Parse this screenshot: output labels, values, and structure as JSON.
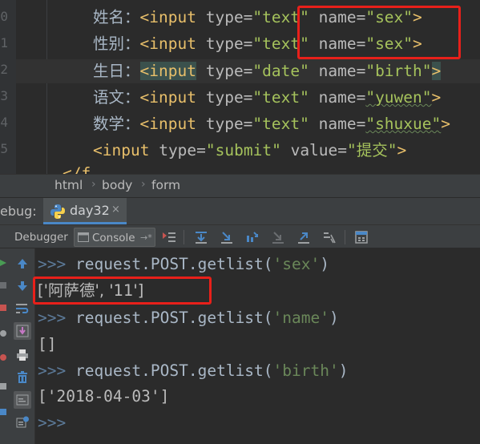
{
  "editor": {
    "line_numbers": [
      "0",
      "1",
      "2",
      "3",
      "4",
      "5"
    ],
    "lines": [
      {
        "label": "姓名：",
        "tag": "<input",
        "attr1": "type=",
        "val1": "\"text\"",
        "attr2": "name=",
        "val2": "\"sex\"",
        "close": ">"
      },
      {
        "label": "性别：",
        "tag": "<input",
        "attr1": "type=",
        "val1": "\"text\"",
        "attr2": "name=",
        "val2": "\"sex\"",
        "close": ">"
      },
      {
        "label": "生日：",
        "tag": "<input",
        "attr1": "type=",
        "val1": "\"date\"",
        "attr2": "name=",
        "val2": "\"birth\"",
        "close": ">"
      },
      {
        "label": "语文：",
        "tag": "<input",
        "attr1": "type=",
        "val1": "\"text\"",
        "attr2": "name=",
        "val2": "\"yuwen\"",
        "close": ">"
      },
      {
        "label": "数学：",
        "tag": "<input",
        "attr1": "type=",
        "val1": "\"text\"",
        "attr2": "name=",
        "val2": "\"shuxue\"",
        "close": ">"
      }
    ],
    "submit_line": {
      "tag": "<input",
      "attr1": "type=",
      "val1": "\"submit\"",
      "attr2": "value=",
      "val2": "\"提交\"",
      "close": ">"
    },
    "partial_line": "</f"
  },
  "breadcrumb": [
    "html",
    "body",
    "form"
  ],
  "debug": {
    "label": "ebug:",
    "tab_name": "day32",
    "close_glyph": "×"
  },
  "toolbar": {
    "debugger_label": "Debugger",
    "console_label": "Console",
    "console_suffix": "→*"
  },
  "console": {
    "prompt": ">>>",
    "lines": [
      {
        "kind": "input",
        "cmd": "request.POST.getlist(",
        "arg": "'sex'",
        "end": ")"
      },
      {
        "kind": "output",
        "text": "['阿萨德', '11']"
      },
      {
        "kind": "input",
        "cmd": "request.POST.getlist(",
        "arg": "'name'",
        "end": ")"
      },
      {
        "kind": "output",
        "text": "[]"
      },
      {
        "kind": "input",
        "cmd": "request.POST.getlist(",
        "arg": "'birth'",
        "end": ")"
      },
      {
        "kind": "output",
        "text": "['2018-04-03']"
      }
    ]
  },
  "colors": {
    "annotation": "#e8201a",
    "tag": "#e8bf6a",
    "string": "#a5c25c",
    "prompt": "#5c7a99",
    "tab_underline": "#4a88c7"
  }
}
